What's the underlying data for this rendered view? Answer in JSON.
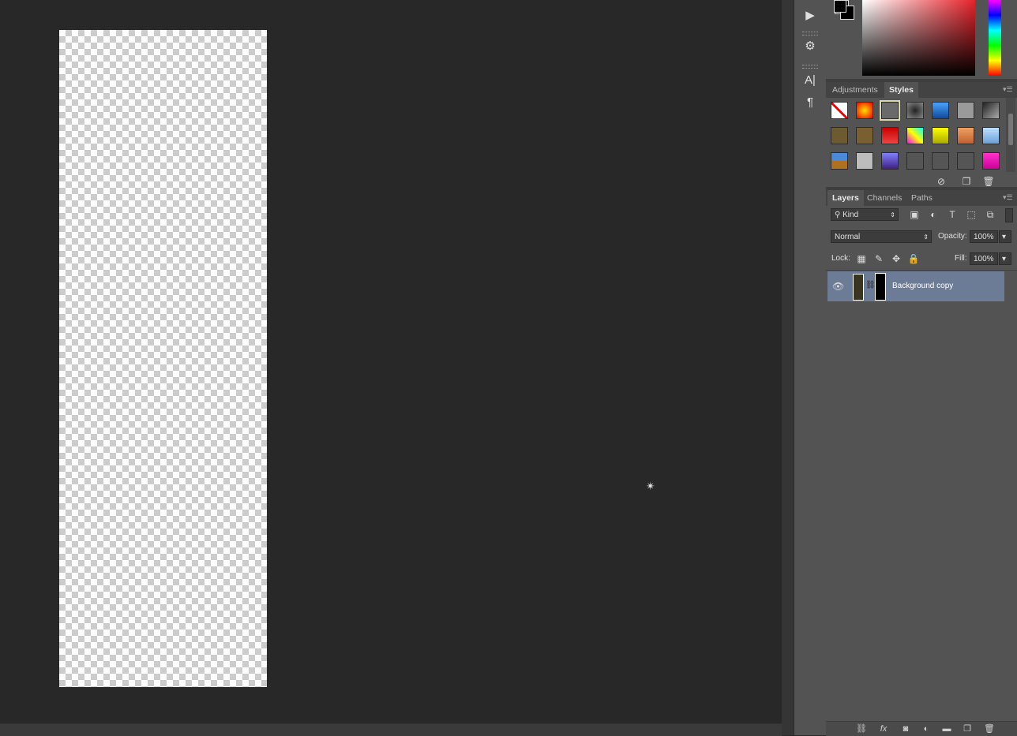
{
  "tools": {
    "play_icon": "play-icon",
    "type_icon_label": "A|",
    "paragraph_icon_label": "¶"
  },
  "styles_panel": {
    "tabs": [
      {
        "label": "Adjustments"
      },
      {
        "label": "Styles"
      }
    ],
    "active_tab": "Styles"
  },
  "layers_panel": {
    "tabs": [
      {
        "label": "Layers"
      },
      {
        "label": "Channels"
      },
      {
        "label": "Paths"
      }
    ],
    "filter_kind": "Kind",
    "blend_mode": "Normal",
    "opacity_label": "Opacity:",
    "opacity_value": "100%",
    "lock_label": "Lock:",
    "fill_label": "Fill:",
    "fill_value": "100%",
    "layers": [
      {
        "name": "Background copy",
        "selected": true,
        "visible": true
      }
    ],
    "footer_fx": "fx"
  },
  "colors": {
    "selection": "#6c7c96",
    "panel_bg": "#535353",
    "workspace_bg": "#282828"
  }
}
